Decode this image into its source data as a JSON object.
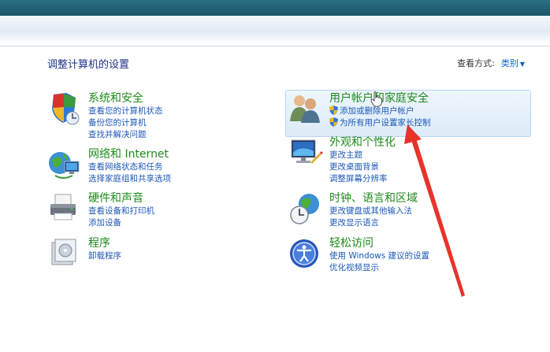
{
  "page_title": "调整计算机的设置",
  "view_by": {
    "label": "查看方式:",
    "value": "类别"
  },
  "categories": [
    {
      "heading": "系统和安全",
      "links": [
        "查看您的计算机状态",
        "备份您的计算机",
        "查找并解决问题"
      ]
    },
    {
      "heading": "网络和 Internet",
      "links": [
        "查看网络状态和任务",
        "选择家庭组和共享选项"
      ]
    },
    {
      "heading": "硬件和声音",
      "links": [
        "查看设备和打印机",
        "添加设备"
      ]
    },
    {
      "heading": "程序",
      "links": [
        "卸载程序"
      ]
    },
    {
      "heading": "用户帐户和家庭安全",
      "links": [
        "添加或删除用户帐户",
        "为所有用户设置家长控制"
      ]
    },
    {
      "heading": "外观和个性化",
      "links": [
        "更改主题",
        "更改桌面背景",
        "调整屏幕分辨率"
      ]
    },
    {
      "heading": "时钟、语言和区域",
      "links": [
        "更改键盘或其他输入法",
        "更改显示语言"
      ]
    },
    {
      "heading": "轻松访问",
      "links": [
        "使用 Windows 建议的设置",
        "优化视频显示"
      ]
    }
  ],
  "colors": {
    "heading": "#1f8a1c",
    "link": "#1c58b8",
    "annotation_arrow": "#e8332a"
  }
}
